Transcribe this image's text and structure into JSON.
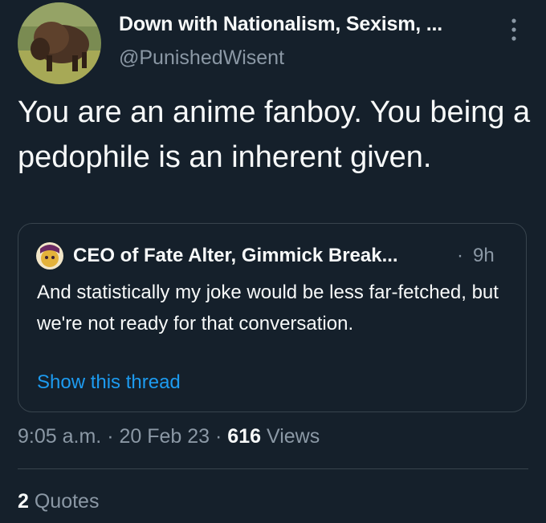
{
  "author": {
    "display_name": "Down with Nationalism, Sexism, ...",
    "handle": "@PunishedWisent",
    "avatar_icon": "bison-avatar"
  },
  "tweet": {
    "text": "You are an anime fanboy. You being a pedophile is an inherent given."
  },
  "quoted_tweet": {
    "display_name": "CEO of Fate Alter, Gimmick Break...",
    "separator": "·",
    "time": "9h",
    "text": "And statistically my joke would be less far-fetched, but we're not ready for that conversation.",
    "show_thread_label": "Show this thread"
  },
  "meta": {
    "time": "9:05 a.m.",
    "sep1": "·",
    "date": "20 Feb 23",
    "sep2": "·",
    "views_count": "616",
    "views_label": "Views"
  },
  "engagement": {
    "quotes_count": "2",
    "quotes_label": "Quotes"
  },
  "colors": {
    "background": "#15202b",
    "text": "#f7f9f9",
    "secondary": "#8b98a5",
    "link": "#1d9bf0",
    "border": "#38444d"
  }
}
